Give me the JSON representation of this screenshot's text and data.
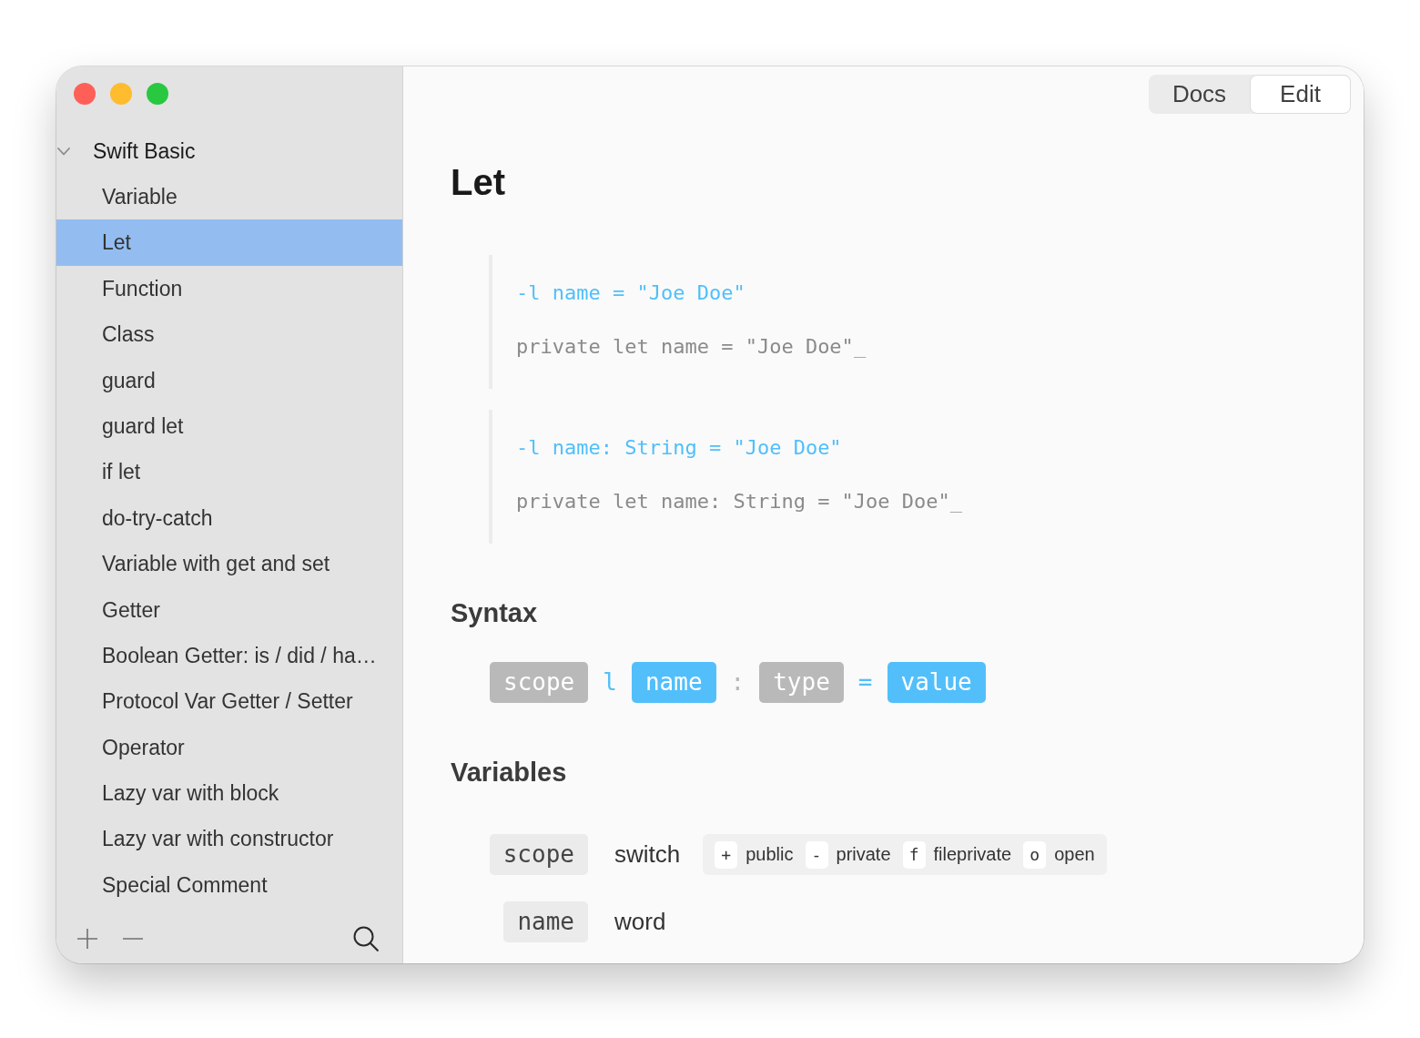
{
  "window": {
    "traffic_lights": [
      {
        "color": "#fe5f57"
      },
      {
        "color": "#febc2e"
      },
      {
        "color": "#28c840"
      }
    ]
  },
  "sidebar": {
    "groups": [
      {
        "title": "Swift Basic",
        "expanded": true,
        "children": [
          {
            "label": "Variable",
            "selected": false
          },
          {
            "label": "Let",
            "selected": true
          },
          {
            "label": "Function",
            "selected": false
          },
          {
            "label": "Class",
            "selected": false
          },
          {
            "label": "guard",
            "selected": false
          },
          {
            "label": "guard let",
            "selected": false
          },
          {
            "label": "if let",
            "selected": false
          },
          {
            "label": "do-try-catch",
            "selected": false
          },
          {
            "label": "Variable with get and set",
            "selected": false
          },
          {
            "label": "Getter",
            "selected": false
          },
          {
            "label": "Boolean Getter: is / did / ha…",
            "selected": false
          },
          {
            "label": "Protocol Var Getter / Setter",
            "selected": false
          },
          {
            "label": "Operator",
            "selected": false
          },
          {
            "label": "Lazy var with block",
            "selected": false
          },
          {
            "label": "Lazy var with constructor",
            "selected": false
          },
          {
            "label": "Special Comment",
            "selected": false
          }
        ]
      }
    ]
  },
  "view_switch": [
    {
      "label": "Docs",
      "selected": false
    },
    {
      "label": "Edit",
      "selected": true
    }
  ],
  "document": {
    "title": "Let",
    "examples": [
      {
        "lines": [
          {
            "kind": "shorthand",
            "text": "-l name = \"Joe Doe\""
          },
          {
            "kind": "expansion",
            "text": "private let name = \"Joe Doe\"",
            "cursor": "_"
          }
        ]
      },
      {
        "lines": [
          {
            "kind": "shorthand",
            "text": "-l name: String = \"Joe Doe\""
          },
          {
            "kind": "expansion",
            "text": "private let name: String = \"Joe Doe\"",
            "cursor": "_"
          }
        ]
      }
    ],
    "syntax": {
      "heading": "Syntax",
      "tokens": [
        {
          "kind": "box",
          "text": "scope",
          "color": "#b9b9b9"
        },
        {
          "kind": "symbol",
          "text": "l",
          "color": "#52bffb"
        },
        {
          "kind": "box",
          "text": "name",
          "color": "#52bffb"
        },
        {
          "kind": "symbol",
          "text": ":",
          "color": "#b9b9b9"
        },
        {
          "kind": "box",
          "text": "type",
          "color": "#b9b9b9"
        },
        {
          "kind": "symbol",
          "text": "=",
          "color": "#52bffb"
        },
        {
          "kind": "box",
          "text": "value",
          "color": "#52bffb"
        }
      ]
    },
    "variables": {
      "heading": "Variables",
      "rows": [
        {
          "term": "scope",
          "description": "switch",
          "options": [
            {
              "symbol": "+",
              "label": "public"
            },
            {
              "symbol": "-",
              "label": "private"
            },
            {
              "symbol": "f",
              "label": "fileprivate"
            },
            {
              "symbol": "o",
              "label": "open"
            }
          ]
        },
        {
          "term": "name",
          "description": "word"
        }
      ]
    }
  }
}
